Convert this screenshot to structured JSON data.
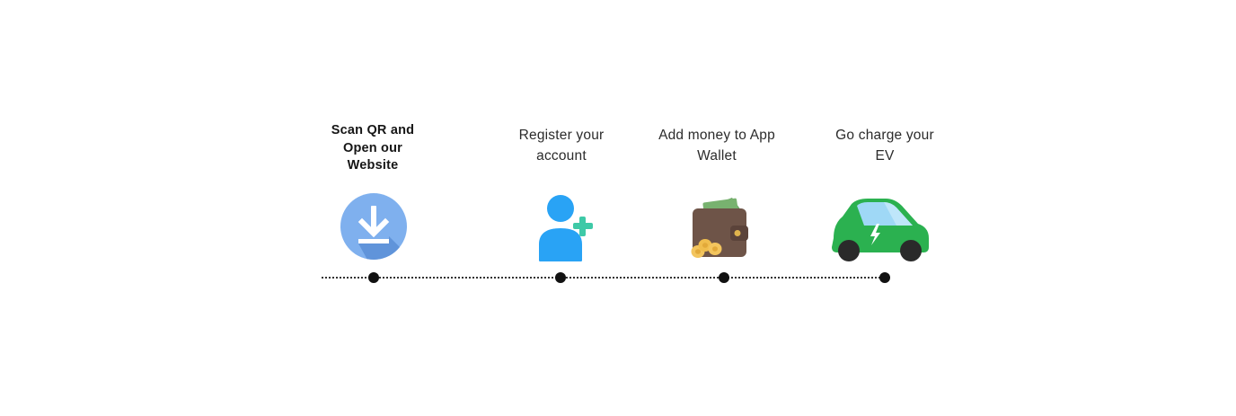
{
  "steps": [
    {
      "label_lines": [
        "Scan QR and",
        "Open our",
        "Website"
      ],
      "icon": "download-icon"
    },
    {
      "label_lines": [
        "Register your",
        "account"
      ],
      "icon": "add-user-icon"
    },
    {
      "label_lines": [
        "Add money to App",
        "Wallet"
      ],
      "icon": "wallet-icon"
    },
    {
      "label_lines": [
        "Go charge your",
        "EV"
      ],
      "icon": "electric-car-icon"
    }
  ],
  "colors": {
    "download_circle": "#7fb0ee",
    "download_shadow": "#5a8fd6",
    "user_blue": "#29a3f5",
    "plus_teal": "#3ec9a7",
    "wallet_brown": "#6e5448",
    "cash_green": "#6ba566",
    "coin_gold": "#f3c55e",
    "car_green": "#2bb150",
    "car_window": "#9fd8f6",
    "timeline": "#333333"
  }
}
